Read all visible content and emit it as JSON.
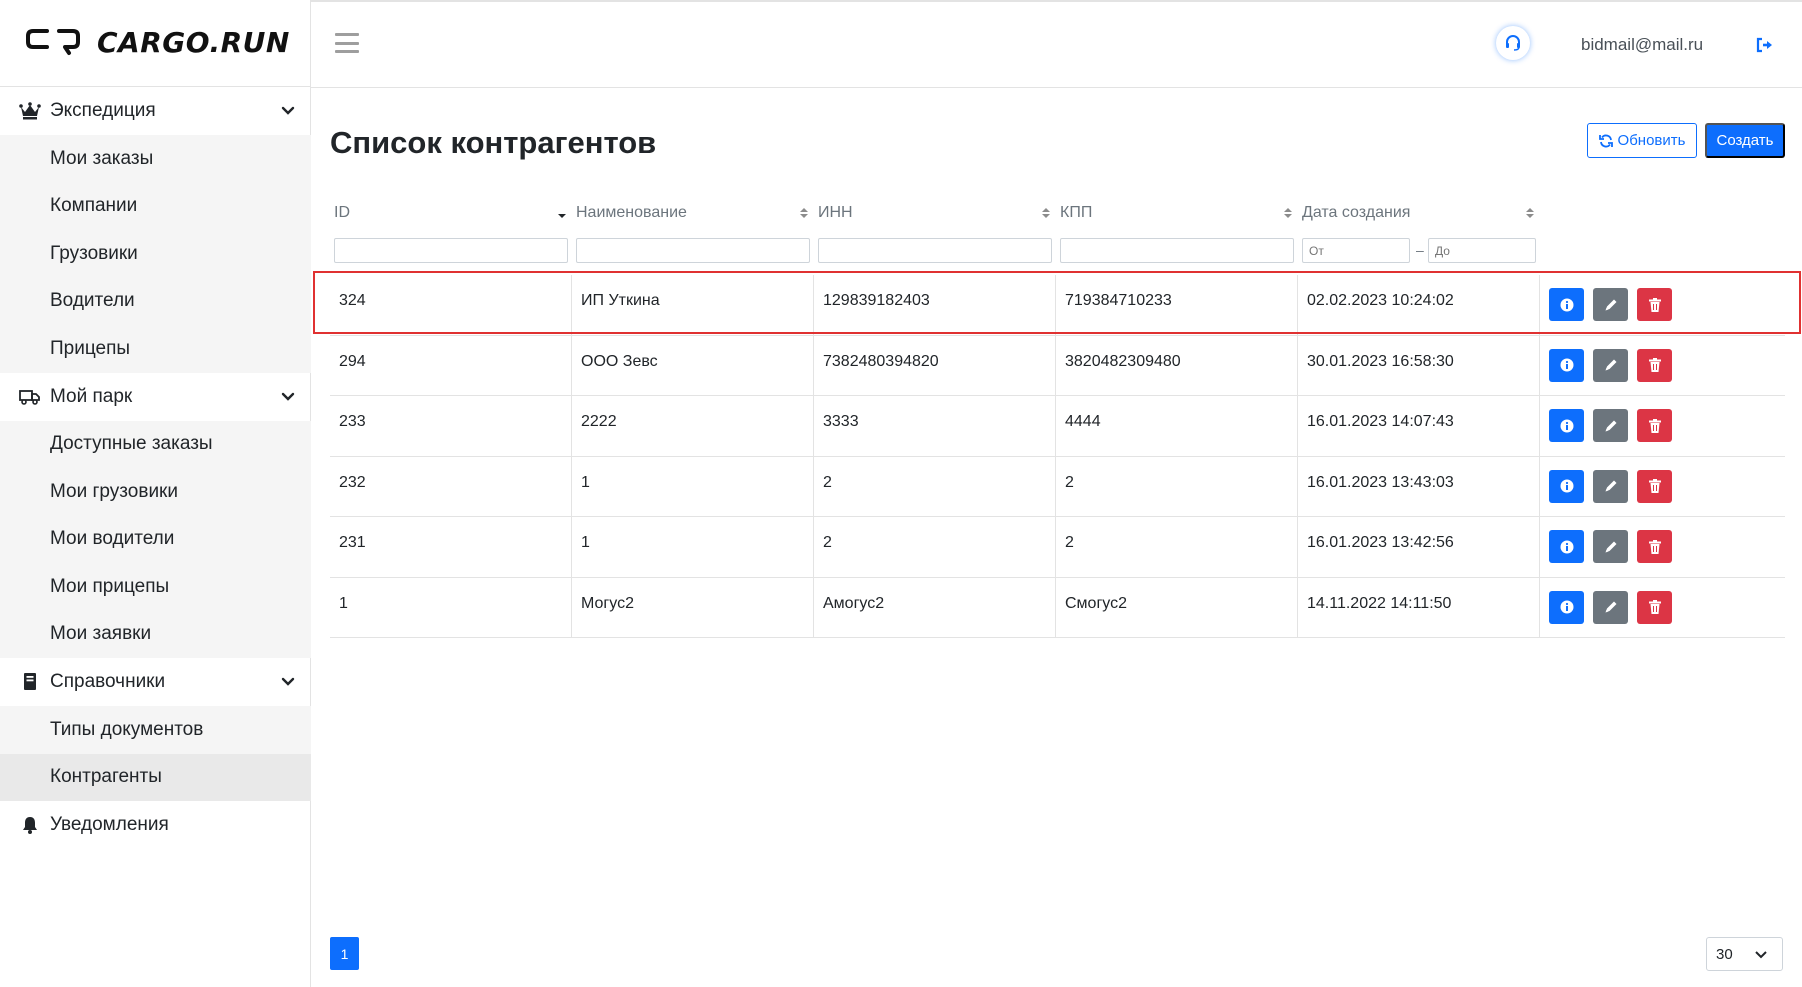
{
  "app": {
    "logo_text": "CARGO.RUN",
    "user_email": "bidmail@mail.ru"
  },
  "sidebar": {
    "groups": [
      {
        "label": "Экспедиция",
        "icon": "crown-icon",
        "items": [
          "Мои заказы",
          "Компании",
          "Грузовики",
          "Водители",
          "Прицепы"
        ]
      },
      {
        "label": "Мой парк",
        "icon": "truck-icon",
        "items": [
          "Доступные заказы",
          "Мои грузовики",
          "Мои водители",
          "Мои прицепы",
          "Мои заявки"
        ]
      },
      {
        "label": "Справочники",
        "icon": "book-icon",
        "items": [
          "Типы документов",
          "Контрагенты"
        ]
      },
      {
        "label": "Уведомления",
        "icon": "bell-icon",
        "items": []
      }
    ],
    "active_item": "Контрагенты"
  },
  "page": {
    "title": "Список контрагентов",
    "refresh_label": "Обновить",
    "create_label": "Создать"
  },
  "table": {
    "columns": [
      "ID",
      "Наименование",
      "ИНН",
      "КПП",
      "Дата создания"
    ],
    "filter_from_placeholder": "От",
    "filter_to_placeholder": "До",
    "filter_dash": "–",
    "rows": [
      [
        "324",
        "ИП Уткина",
        "129839182403",
        "719384710233",
        "02.02.2023 10:24:02"
      ],
      [
        "294",
        "ООО Зевс",
        "7382480394820",
        "3820482309480",
        "30.01.2023 16:58:30"
      ],
      [
        "233",
        "2222",
        "3333",
        "4444",
        "16.01.2023 14:07:43"
      ],
      [
        "232",
        "1",
        "2",
        "2",
        "16.01.2023 13:43:03"
      ],
      [
        "231",
        "1",
        "2",
        "2",
        "16.01.2023 13:42:56"
      ],
      [
        "1",
        "Могус2",
        "Амогус2",
        "Смогус2",
        "14.11.2022 14:11:50"
      ]
    ],
    "highlighted_row": 0
  },
  "pagination": {
    "current_page": "1",
    "page_size": "30"
  },
  "colors": {
    "primary": "#0d6efd",
    "secondary": "#6c757d",
    "danger": "#dc3545",
    "highlight": "#e03131"
  }
}
